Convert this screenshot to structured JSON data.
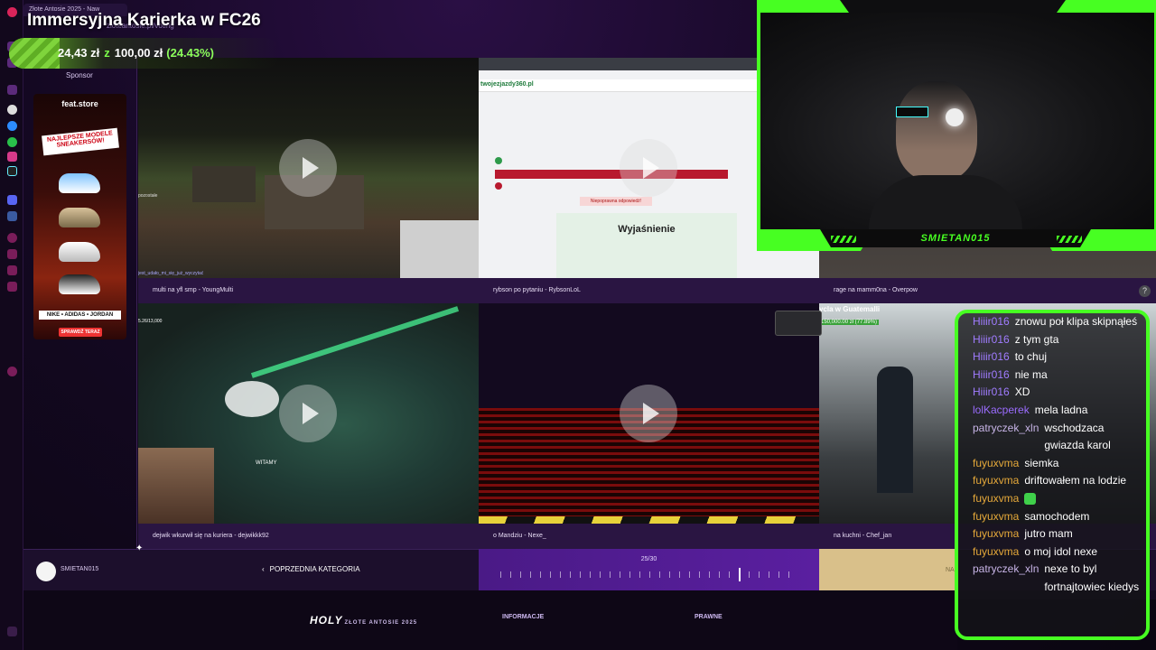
{
  "browser": {
    "tab_title": "Złote Antosie 2025 - Naw",
    "url_fragment": "zloteantosie.pl/voting"
  },
  "stream": {
    "title": "Immersyjna Karierka w FC26",
    "donation": {
      "amount": "24,43 zł",
      "separator": "z",
      "goal": "100,00 zł",
      "percent": "(24.43%)"
    },
    "sponsor_label": "Sponsor"
  },
  "sponsor_ad": {
    "brand": "feat.store",
    "headline": "NAJLEPSZE MODELE SNEAKERSÓW!",
    "brands": "NIKE • ADIDAS • JORDAN",
    "cta": "SPRAWDŹ TERAZ"
  },
  "tiles": [
    {
      "caption": "multi na yfl smp - YoungMulti",
      "overlay": "pozostałe",
      "overlay2": "jest_udało_mi_się_już_wyczytać"
    },
    {
      "caption": "rybson po pytaniu - RybsonLoL",
      "quiz_logo": "twojezjazdy360.pl",
      "quiz_heading": "Wyjaśnienie",
      "quiz_button": "Niepoprawna odpowiedź!"
    },
    {
      "caption": "rage na mamm0na - Overpow"
    },
    {
      "caption": "dejwik wkurwił się na kuriera - dejwikkk92",
      "overlay": "WITAMY",
      "overlay2": "5.26/13,000"
    },
    {
      "caption": "o Mandziu - Nexe_"
    },
    {
      "caption": "na kuchni - Chef_jan",
      "overlay": "ycla w Guatemalli",
      "overlay2": "150,000.00 zł (77.89%)"
    }
  ],
  "bottom_bar": {
    "username": "SMIETAN015",
    "prev_category": "POPRZEDNIA KATEGORIA",
    "progress": "25/30",
    "progress_current": 25,
    "progress_total": 30,
    "next_prefix": "NA"
  },
  "footer": {
    "logo": "HOLY",
    "logo_sub": "ZŁOTE ANTOSIE 2025",
    "col1": "INFORMACJE",
    "col2": "PRAWNE"
  },
  "webcam": {
    "streamer_name": "SMIETAN015",
    "frame_color": "#47ff22"
  },
  "chat": [
    {
      "user": "Hiiir016",
      "color": "#a07cff",
      "msg": "znowu poł klipa skipnąłeś"
    },
    {
      "user": "Hiiir016",
      "color": "#a07cff",
      "msg": "z tym gta"
    },
    {
      "user": "Hiiir016",
      "color": "#a07cff",
      "msg": "to chuj"
    },
    {
      "user": "Hiiir016",
      "color": "#a07cff",
      "msg": "nie ma"
    },
    {
      "user": "Hiiir016",
      "color": "#a07cff",
      "msg": "XD"
    },
    {
      "user": "lolKacperek",
      "color": "#9b6cff",
      "msg": "mela ladna"
    },
    {
      "user": "patryczek_xln",
      "color": "#c7b4e6",
      "msg": "wschodzaca gwiazda karol"
    },
    {
      "user": "fuyuxvma",
      "color": "#e6a93a",
      "msg": "siemka"
    },
    {
      "user": "fuyuxvma",
      "color": "#e6a93a",
      "msg": "driftowałem na lodzie"
    },
    {
      "user": "fuyuxvma",
      "color": "#e6a93a",
      "msg": "",
      "emote": true
    },
    {
      "user": "fuyuxvma",
      "color": "#e6a93a",
      "msg": "samochodem"
    },
    {
      "user": "fuyuxvma",
      "color": "#e6a93a",
      "msg": "jutro mam"
    },
    {
      "user": "fuyuxvma",
      "color": "#e6a93a",
      "msg": "o moj idol nexe"
    },
    {
      "user": "patryczek_xln",
      "color": "#c7b4e6",
      "msg": "nexe to byl fortnajtowiec kiedys"
    }
  ],
  "help_label": "?"
}
